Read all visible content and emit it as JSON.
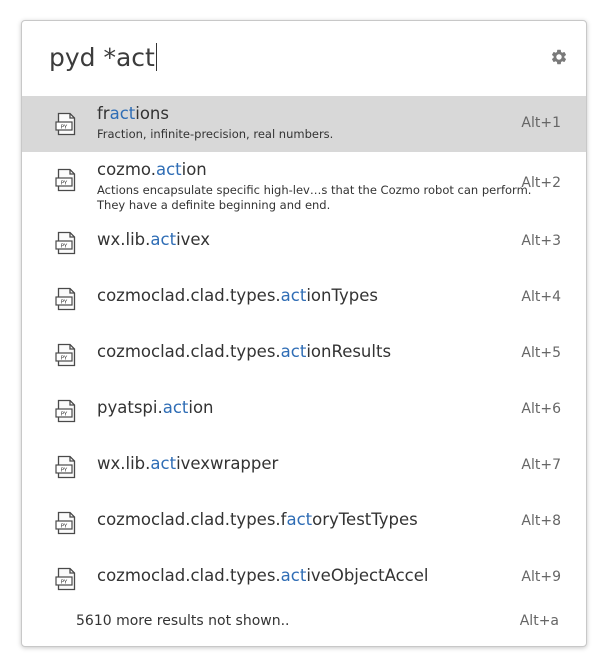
{
  "search": {
    "query": "pyd *act"
  },
  "settings_icon": "gear-icon",
  "result_icon": "python-file-icon",
  "highlight_color": "#2f6db5",
  "selected_bg": "#d8d8d8",
  "results": [
    {
      "title_pre": "fr",
      "title_hl": "act",
      "title_post": "ions",
      "desc": [
        "Fraction, infinite-precision, real numbers."
      ],
      "shortcut": "Alt+1",
      "selected": true
    },
    {
      "title_pre": "cozmo.",
      "title_hl": "act",
      "title_post": "ion",
      "desc": [
        "Actions encapsulate specific high-lev…s that the Cozmo robot can perform.",
        "They have a definite beginning and end."
      ],
      "shortcut": "Alt+2",
      "selected": false
    },
    {
      "title_pre": "wx.lib.",
      "title_hl": "act",
      "title_post": "ivex",
      "desc": [],
      "shortcut": "Alt+3",
      "selected": false
    },
    {
      "title_pre": "cozmoclad.clad.types.",
      "title_hl": "act",
      "title_post": "ionTypes",
      "desc": [],
      "shortcut": "Alt+4",
      "selected": false
    },
    {
      "title_pre": "cozmoclad.clad.types.",
      "title_hl": "act",
      "title_post": "ionResults",
      "desc": [],
      "shortcut": "Alt+5",
      "selected": false
    },
    {
      "title_pre": "pyatspi.",
      "title_hl": "act",
      "title_post": "ion",
      "desc": [],
      "shortcut": "Alt+6",
      "selected": false
    },
    {
      "title_pre": "wx.lib.",
      "title_hl": "act",
      "title_post": "ivexwrapper",
      "desc": [],
      "shortcut": "Alt+7",
      "selected": false
    },
    {
      "title_pre": "cozmoclad.clad.types.f",
      "title_hl": "act",
      "title_post": "oryTestTypes",
      "desc": [],
      "shortcut": "Alt+8",
      "selected": false
    },
    {
      "title_pre": "cozmoclad.clad.types.",
      "title_hl": "act",
      "title_post": "iveObjectAccel",
      "desc": [],
      "shortcut": "Alt+9",
      "selected": false
    }
  ],
  "footer": {
    "more_text": "5610 more results not shown..",
    "shortcut": "Alt+a"
  }
}
